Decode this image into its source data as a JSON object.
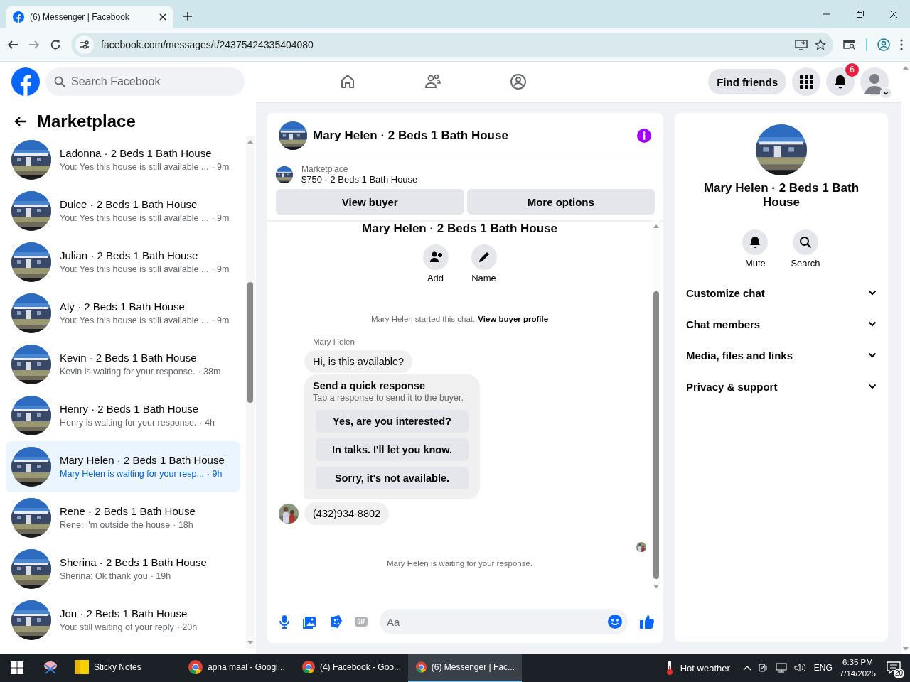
{
  "browser": {
    "tab": {
      "title": "(6) Messenger | Facebook",
      "selected": true
    },
    "url": "facebook.com/messages/t/24375424335404080"
  },
  "header": {
    "search": {
      "placeholder": "Search Facebook"
    },
    "nav": [
      {
        "kind": "home"
      },
      {
        "kind": "friends"
      },
      {
        "kind": "groups"
      }
    ],
    "find_friends": "Find friends",
    "notification_count": "6"
  },
  "sidebar": {
    "title": "Marketplace",
    "conversations": [
      {
        "name": "Ladonna · 2 Beds 1 Bath House",
        "preview": "You: Yes this house is still available ...",
        "time": "· 9m",
        "selected": false
      },
      {
        "name": "Dulce · 2 Beds 1 Bath House",
        "preview": "You: Yes this house is still available ...",
        "time": "· 9m",
        "selected": false
      },
      {
        "name": "Julian · 2 Beds 1 Bath House",
        "preview": "You: Yes this house is still available ...",
        "time": "· 9m",
        "selected": false
      },
      {
        "name": "Aly · 2 Beds 1 Bath House",
        "preview": "You: Yes this house is still available ...",
        "time": "· 9m",
        "selected": false
      },
      {
        "name": "Kevin · 2 Beds 1 Bath House",
        "preview": "Kevin is waiting for your response.",
        "time": "· 38m",
        "selected": false
      },
      {
        "name": "Henry · 2 Beds 1 Bath House",
        "preview": "Henry is waiting for your response.",
        "time": "· 4h",
        "selected": false
      },
      {
        "name": "Mary Helen · 2 Beds 1 Bath House",
        "preview": "Mary Helen is waiting for your resp...",
        "time": "· 9h",
        "selected": true
      },
      {
        "name": "Rene · 2 Beds 1 Bath House",
        "preview": "Rene: I'm outside the house",
        "time": "· 18h",
        "selected": false
      },
      {
        "name": "Sherina · 2 Beds 1 Bath House",
        "preview": "Sherina: Ok thank you",
        "time": "· 19h",
        "selected": false
      },
      {
        "name": "Jon · 2 Beds 1 Bath House",
        "preview": "You: still waiting of your reply",
        "time": "· 20h",
        "selected": false
      }
    ]
  },
  "chat": {
    "title": "Mary Helen · 2 Beds 1 Bath House",
    "listing": {
      "source": "Marketplace",
      "title": "$750 - 2 Beds 1 Bath House"
    },
    "buttons": [
      "View buyer",
      "More options"
    ],
    "intro": {
      "title": "Mary Helen · 2 Beds 1 Bath House",
      "actions": [
        {
          "kind": "add",
          "label": "Add"
        },
        {
          "kind": "name",
          "label": "Name"
        }
      ]
    },
    "started_text": "Mary Helen started this chat.",
    "started_link": "View buyer profile",
    "sender": "Mary Helen",
    "message": "Hi, is this available?",
    "quick_response": {
      "title": "Send a quick response",
      "subtitle": "Tap a response to send it to the buyer.",
      "options": [
        "Yes, are you interested?",
        "In talks. I'll let you know.",
        "Sorry, it's not available."
      ]
    },
    "phone_message": "(432)934-8802",
    "waiting": "Mary Helen is waiting for your response.",
    "composer": {
      "placeholder": "Aa"
    }
  },
  "info": {
    "title": "Mary Helen · 2 Beds 1 Bath House",
    "actions": [
      {
        "kind": "mute",
        "label": "Mute"
      },
      {
        "kind": "search",
        "label": "Search"
      }
    ],
    "sections": [
      "Customize chat",
      "Chat members",
      "Media, files and links",
      "Privacy & support"
    ]
  },
  "taskbar": {
    "apps": [
      {
        "kind": "snip"
      },
      {
        "kind": "notes",
        "label": "Sticky Notes",
        "selected": false
      },
      {
        "kind": "chrome",
        "label": "apna maal - Googl...",
        "selected": false
      },
      {
        "kind": "chrome",
        "label": "(4) Facebook - Goo...",
        "selected": false
      },
      {
        "kind": "chrome",
        "label": "(6) Messenger | Fac...",
        "selected": true
      }
    ],
    "weather": "Hot weather",
    "language": "ENG",
    "time": "6:35 PM",
    "date": "7/14/2025",
    "notifications": "20"
  }
}
